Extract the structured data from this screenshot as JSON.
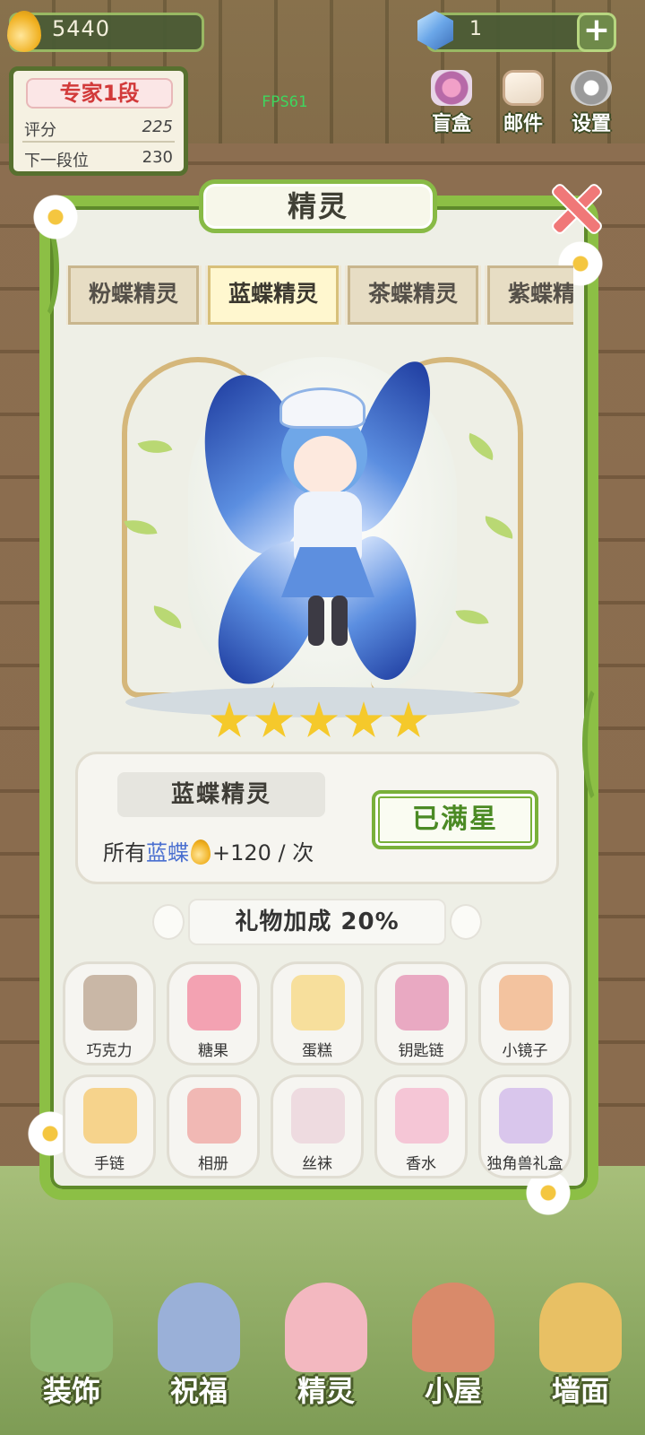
{
  "hud": {
    "coins": "5440",
    "gems": "1",
    "plus_label": "+",
    "rank": {
      "title": "专家1段",
      "score_label": "评分",
      "score_value": "225",
      "next_label": "下一段位",
      "next_value": "230"
    },
    "fps": "FPS61",
    "top_buttons": [
      {
        "label": "盲盒",
        "icon": "blindbox-icon"
      },
      {
        "label": "邮件",
        "icon": "mail-icon"
      },
      {
        "label": "设置",
        "icon": "gear-icon"
      }
    ]
  },
  "panel": {
    "title": "精灵",
    "tabs": [
      {
        "label": "粉蝶精灵",
        "active": false
      },
      {
        "label": "蓝蝶精灵",
        "active": true
      },
      {
        "label": "茶蝶精灵",
        "active": false
      },
      {
        "label": "紫蝶精灵",
        "active": false
      }
    ],
    "stars": 5,
    "spirit_name": "蓝蝶精灵",
    "bonus": {
      "prefix": "所有",
      "target": "蓝蝶",
      "amount": "+120",
      "suffix": " / 次"
    },
    "max_star_button": "已满星",
    "gift_bonus": "礼物加成 20%",
    "gifts": [
      {
        "label": "巧克力",
        "icon": "chocolate-icon",
        "color": "#c9b7a6"
      },
      {
        "label": "糖果",
        "icon": "candy-jar-icon",
        "color": "#f3a2b2"
      },
      {
        "label": "蛋糕",
        "icon": "cake-icon",
        "color": "#f7df9c"
      },
      {
        "label": "钥匙链",
        "icon": "keychain-icon",
        "color": "#e9a9c2"
      },
      {
        "label": "小镜子",
        "icon": "mirror-icon",
        "color": "#f3c39f"
      },
      {
        "label": "手链",
        "icon": "bracelet-icon",
        "color": "#f6d38c"
      },
      {
        "label": "相册",
        "icon": "photo-album-icon",
        "color": "#f1b8b4"
      },
      {
        "label": "丝袜",
        "icon": "stockings-icon",
        "color": "#eedbe0"
      },
      {
        "label": "香水",
        "icon": "perfume-icon",
        "color": "#f5c6d6"
      },
      {
        "label": "独角兽礼盒",
        "icon": "unicorn-giftbox-icon",
        "color": "#d9c6ec"
      }
    ]
  },
  "bottom_nav": [
    {
      "label": "装饰",
      "icon": "plant-icon",
      "color": "#8fb870"
    },
    {
      "label": "祝福",
      "icon": "butterfly-icon",
      "color": "#9ab0d8"
    },
    {
      "label": "精灵",
      "icon": "fairy-icon",
      "color": "#f3b8c0"
    },
    {
      "label": "小屋",
      "icon": "house-icon",
      "color": "#d98a6a"
    },
    {
      "label": "墙面",
      "icon": "bell-icon",
      "color": "#e8c064"
    }
  ]
}
